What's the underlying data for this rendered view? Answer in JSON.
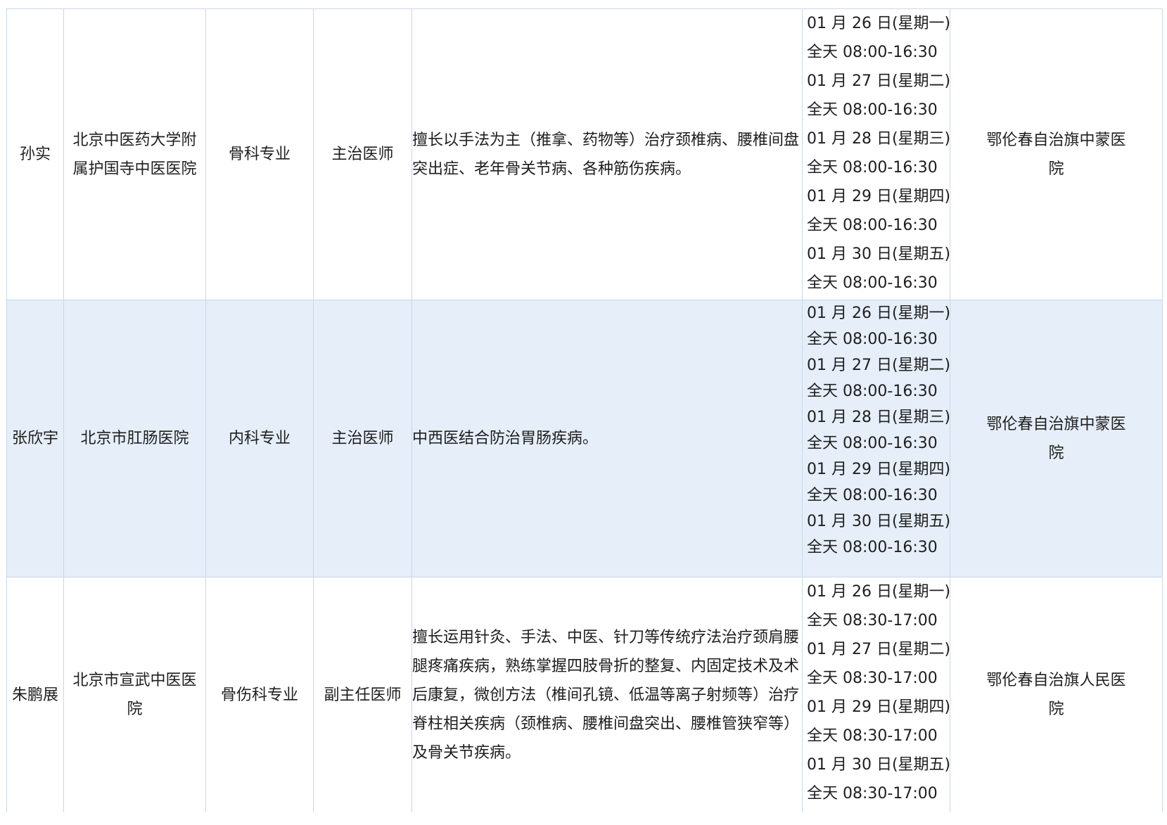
{
  "rows": [
    {
      "name": "孙实",
      "hospital": [
        "北京中医药大学附",
        "属护国寺中医医院"
      ],
      "department": "骨科专业",
      "title": "主治医师",
      "specialty": "擅长以手法为主（推拿、药物等）治疗颈椎病、腰椎间盘突出症、老年骨关节病、各种筋伤疾病。",
      "schedule": [
        "01 月 26 日(星期一)",
        "全天 08:00-16:30",
        "01 月 27 日(星期二)",
        "全天 08:00-16:30",
        "01 月 28 日(星期三)",
        "全天 08:00-16:30",
        "01 月 29 日(星期四)",
        "全天 08:00-16:30",
        "01 月 30 日(星期五)",
        "全天 08:00-16:30"
      ],
      "site": [
        "鄂伦春自治旗中蒙医",
        "院"
      ]
    },
    {
      "name": "张欣宇",
      "hospital": [
        "北京市肛肠医院"
      ],
      "department": "内科专业",
      "title": "主治医师",
      "specialty": "中西医结合防治胃肠疾病。",
      "schedule": [
        "01 月 26 日(星期一)",
        "全天 08:00-16:30",
        "01 月 27 日(星期二)",
        "全天 08:00-16:30",
        "01 月 28 日(星期三)",
        "全天 08:00-16:30",
        "01 月 29 日(星期四)",
        "全天 08:00-16:30",
        "01 月 30 日(星期五)",
        "全天 08:00-16:30"
      ],
      "site": [
        "鄂伦春自治旗中蒙医",
        "院"
      ]
    },
    {
      "name": "朱鹏展",
      "hospital": [
        "北京市宣武中医医",
        "院"
      ],
      "department": "骨伤科专业",
      "title": "副主任医师",
      "specialty": "擅长运用针灸、手法、中医、针刀等传统疗法治疗颈肩腰腿疼痛疾病，熟练掌握四肢骨折的整复、内固定技术及术后康复，微创方法（椎间孔镜、低温等离子射频等）治疗脊柱相关疾病（颈椎病、腰椎间盘突出、腰椎管狭窄等）及骨关节疾病。",
      "schedule": [
        "01 月 26 日(星期一)",
        "全天 08:30-17:00",
        "01 月 27 日(星期二)",
        "全天 08:30-17:00",
        "01 月 29 日(星期四)",
        "全天 08:30-17:00",
        "01 月 30 日(星期五)",
        "全天 08:30-17:00"
      ],
      "site": [
        "鄂伦春自治旗人民医",
        "院"
      ]
    }
  ]
}
